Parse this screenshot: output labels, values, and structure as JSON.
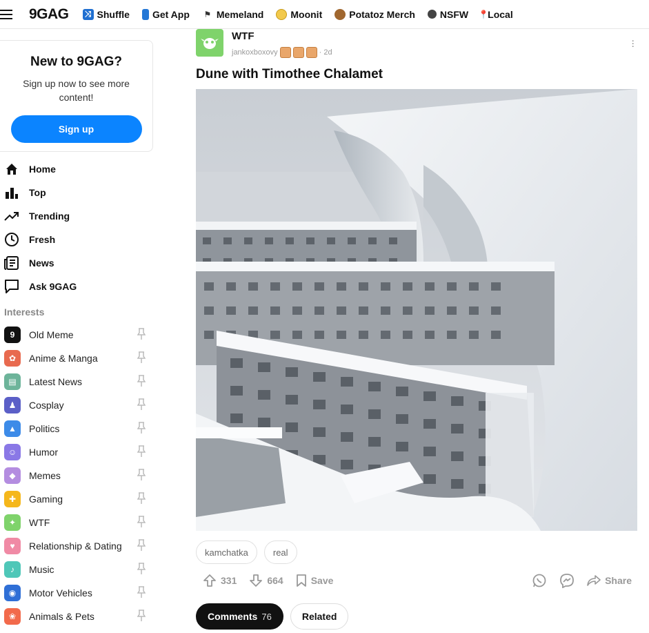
{
  "header": {
    "logo": "9GAG",
    "links": [
      {
        "label": "Shuffle",
        "icon": "shuffle-icon",
        "color": "#1f6fd1"
      },
      {
        "label": "Get App",
        "icon": "phone-icon",
        "color": "#2477d6"
      },
      {
        "label": "Memeland",
        "icon": "flag-icon",
        "color": "#333333"
      },
      {
        "label": "Moonit",
        "icon": "coin-icon",
        "color": "#f2c94c"
      },
      {
        "label": "Potatoz Merch",
        "icon": "potato-icon",
        "color": "#a0672f"
      },
      {
        "label": "NSFW",
        "icon": "bomb-icon",
        "color": "#444444"
      },
      {
        "label": "Local",
        "icon": "pin-icon",
        "color": "#d9402b"
      }
    ]
  },
  "signup": {
    "title": "New to 9GAG?",
    "text": "Sign up now to see more content!",
    "button": "Sign up",
    "accent": "#0b84ff"
  },
  "mainnav": [
    {
      "label": "Home",
      "icon": "home-icon"
    },
    {
      "label": "Top",
      "icon": "bar-chart-icon"
    },
    {
      "label": "Trending",
      "icon": "trending-icon"
    },
    {
      "label": "Fresh",
      "icon": "clock-icon"
    },
    {
      "label": "News",
      "icon": "newspaper-icon"
    },
    {
      "label": "Ask 9GAG",
      "icon": "chat-icon"
    }
  ],
  "interests_label": "Interests",
  "interests": [
    {
      "label": "Old Meme",
      "color": "#111111",
      "glyph": "9"
    },
    {
      "label": "Anime & Manga",
      "color": "#e86a4f",
      "glyph": "✿"
    },
    {
      "label": "Latest News",
      "color": "#6db49a",
      "glyph": "▤"
    },
    {
      "label": "Cosplay",
      "color": "#5b5fc7",
      "glyph": "♟"
    },
    {
      "label": "Politics",
      "color": "#3d8be8",
      "glyph": "▲"
    },
    {
      "label": "Humor",
      "color": "#8a78e6",
      "glyph": "☺"
    },
    {
      "label": "Memes",
      "color": "#b48de0",
      "glyph": "◆"
    },
    {
      "label": "Gaming",
      "color": "#f5b71b",
      "glyph": "✚"
    },
    {
      "label": "WTF",
      "color": "#7fd36b",
      "glyph": "✦"
    },
    {
      "label": "Relationship & Dating",
      "color": "#f08aa5",
      "glyph": "♥"
    },
    {
      "label": "Music",
      "color": "#4fc7b8",
      "glyph": "♪"
    },
    {
      "label": "Motor Vehicles",
      "color": "#2f6fd6",
      "glyph": "◉"
    },
    {
      "label": "Animals & Pets",
      "color": "#f26a4b",
      "glyph": "❀"
    }
  ],
  "post": {
    "section": "WTF",
    "author": "jankoxboxovy",
    "age": "· 2d",
    "title": "Dune with Timothee Chalamet",
    "tags": [
      "kamchatka",
      "real"
    ],
    "upvotes": "331",
    "downvotes": "664",
    "save": "Save",
    "share": "Share",
    "tabs": {
      "comments": "Comments",
      "comments_count": "76",
      "related": "Related"
    }
  }
}
